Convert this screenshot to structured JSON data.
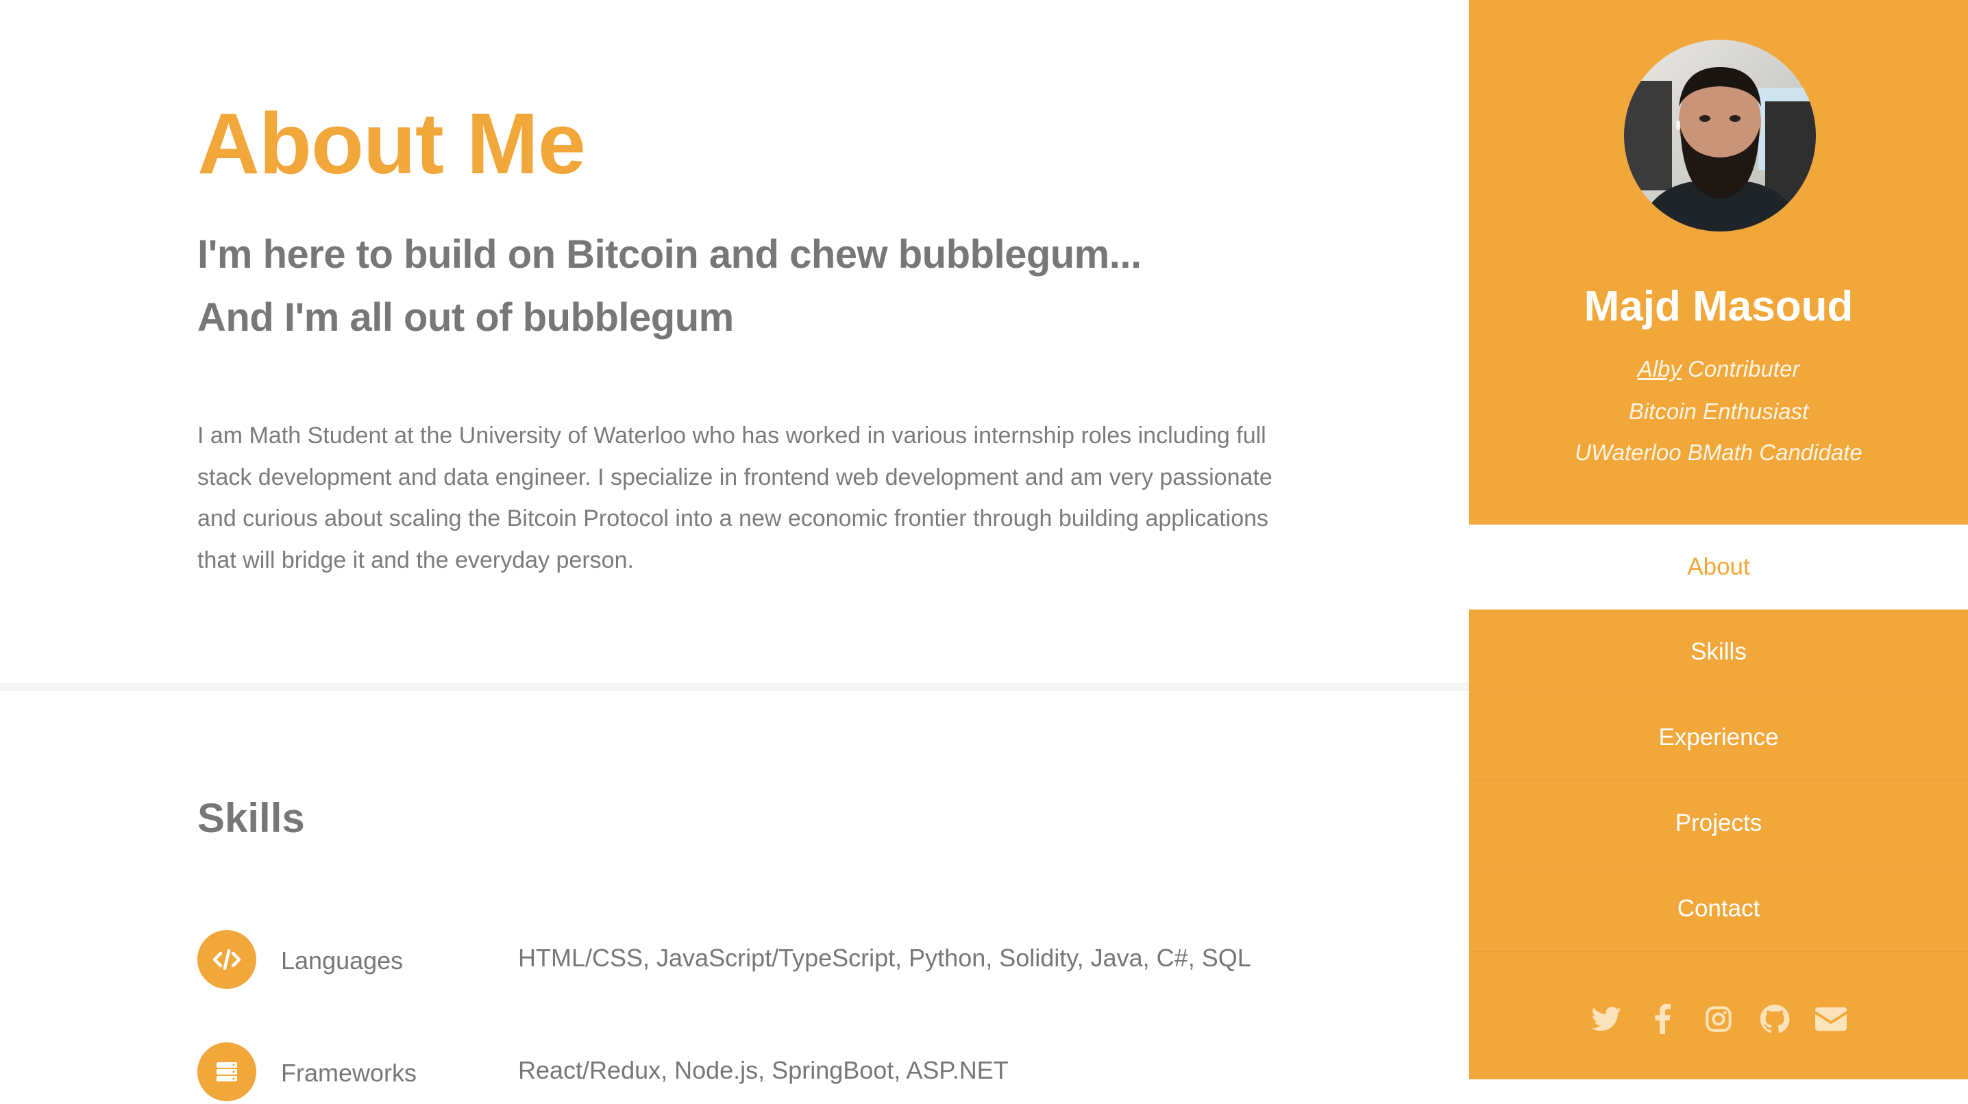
{
  "about": {
    "title": "About Me",
    "subtitle_line1": "I'm here to build on Bitcoin and chew bubblegum...",
    "subtitle_line2": "And I'm all out of bubblegum",
    "bio": "I am Math Student at the University of Waterloo who has worked in various internship roles including full stack development and data engineer. I specialize in frontend web development and am very passionate and curious about scaling the Bitcoin Protocol into a new economic frontier through building applications that will bridge it and the everyday person."
  },
  "skills": {
    "title": "Skills",
    "rows": [
      {
        "icon": "code-icon",
        "label": "Languages",
        "value": "HTML/CSS, JavaScript/TypeScript, Python, Solidity, Java, C#, SQL"
      },
      {
        "icon": "server-icon",
        "label": "Frameworks",
        "value": "React/Redux, Node.js, SpringBoot, ASP.NET"
      }
    ]
  },
  "sidebar": {
    "name": "Majd Masoud",
    "tagline_link": "Alby",
    "tagline_1_rest": " Contributer",
    "tagline_2": "Bitcoin Enthusiast",
    "tagline_3": "UWaterloo BMath Candidate",
    "nav": [
      "About",
      "Skills",
      "Experience",
      "Projects",
      "Contact"
    ],
    "active_nav": "About",
    "social_icons": [
      "twitter-icon",
      "facebook-icon",
      "instagram-icon",
      "github-icon",
      "envelope-icon"
    ]
  },
  "colors": {
    "accent": "#f2a73b",
    "text": "#777777",
    "white": "#ffffff"
  }
}
